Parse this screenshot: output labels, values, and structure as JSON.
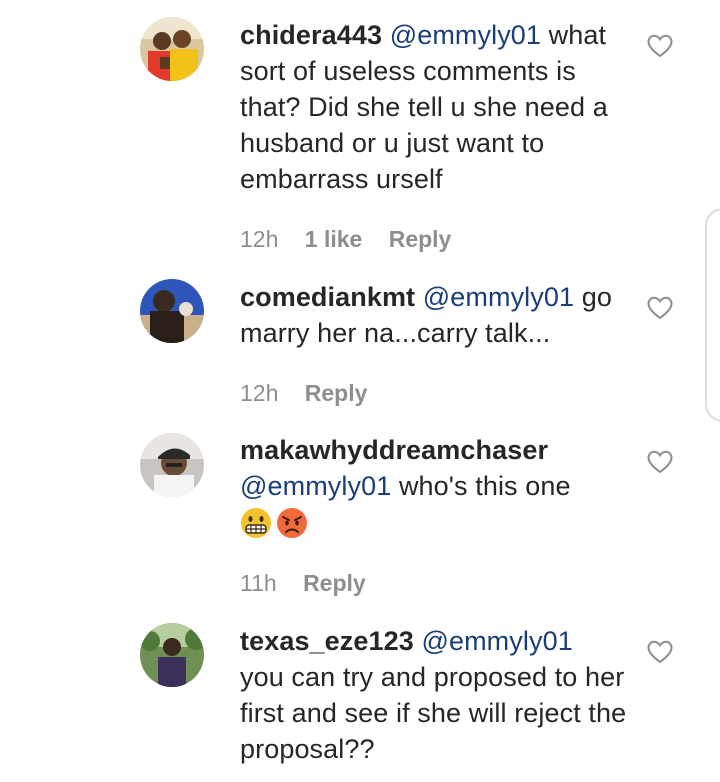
{
  "comments": [
    {
      "username": "chidera443",
      "mention": "@emmyly01",
      "text": " what sort of useless comments is that? Did she tell u she need a husband or u just want to embarrass urself",
      "time": "12h",
      "likes": "1 like",
      "reply": "Reply",
      "avatar_icon": "avatar-photo-two-people"
    },
    {
      "username": "comediankmt",
      "mention": "@emmyly01",
      "text": " go marry her na...carry talk...",
      "time": "12h",
      "reply": "Reply",
      "avatar_icon": "avatar-photo-person-blue"
    },
    {
      "username": "makawhyddreamchaser",
      "mention": "@emmyly01",
      "text": " who's this one",
      "emojis": [
        "grimacing-face-emoji",
        "angry-face-emoji"
      ],
      "time": "11h",
      "reply": "Reply",
      "avatar_icon": "avatar-photo-man-cap"
    },
    {
      "username": "texas_eze123",
      "mention": "@emmyly01",
      "text": " you can try and proposed to her first and see if she will reject the proposal??",
      "avatar_icon": "avatar-photo-man-outdoors"
    }
  ],
  "icons": {
    "like": "heart-outline-icon"
  },
  "colors": {
    "text": "#262626",
    "mention": "#1a3e7a",
    "meta": "#8e8e8e"
  }
}
